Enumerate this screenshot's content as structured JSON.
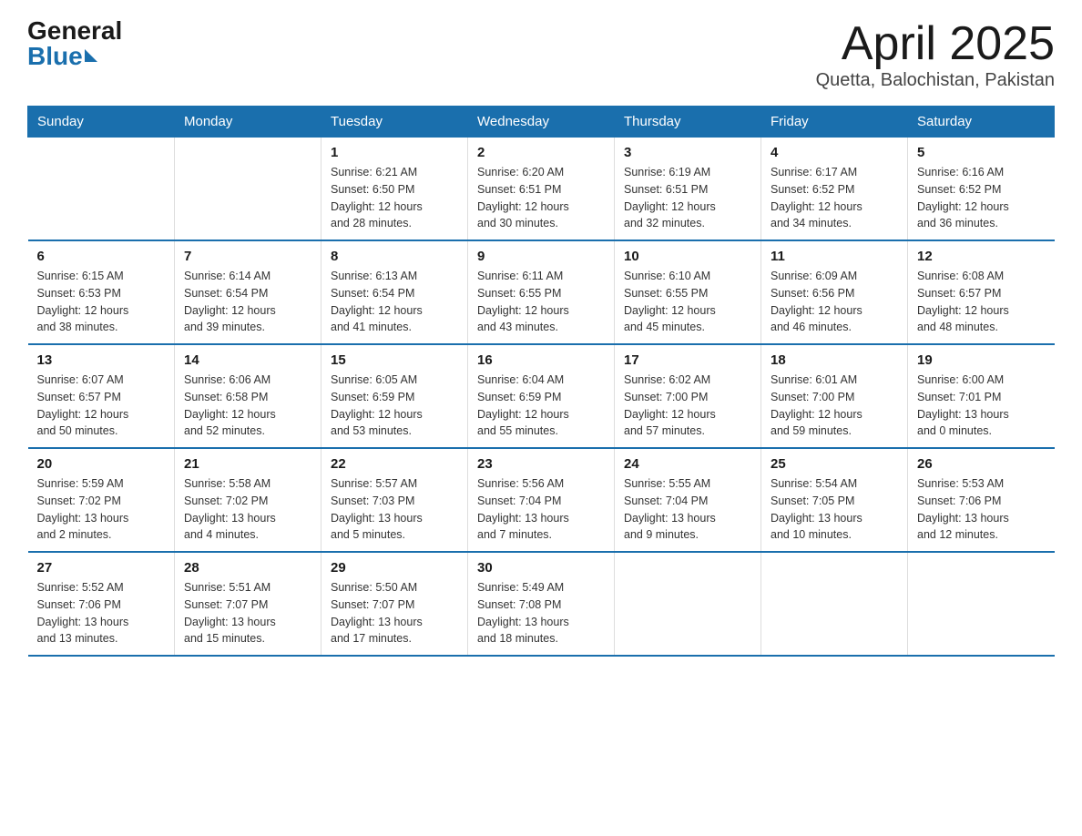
{
  "logo": {
    "general": "General",
    "blue": "Blue"
  },
  "title": "April 2025",
  "location": "Quetta, Balochistan, Pakistan",
  "days_of_week": [
    "Sunday",
    "Monday",
    "Tuesday",
    "Wednesday",
    "Thursday",
    "Friday",
    "Saturday"
  ],
  "weeks": [
    [
      {
        "day": "",
        "info": ""
      },
      {
        "day": "",
        "info": ""
      },
      {
        "day": "1",
        "info": "Sunrise: 6:21 AM\nSunset: 6:50 PM\nDaylight: 12 hours\nand 28 minutes."
      },
      {
        "day": "2",
        "info": "Sunrise: 6:20 AM\nSunset: 6:51 PM\nDaylight: 12 hours\nand 30 minutes."
      },
      {
        "day": "3",
        "info": "Sunrise: 6:19 AM\nSunset: 6:51 PM\nDaylight: 12 hours\nand 32 minutes."
      },
      {
        "day": "4",
        "info": "Sunrise: 6:17 AM\nSunset: 6:52 PM\nDaylight: 12 hours\nand 34 minutes."
      },
      {
        "day": "5",
        "info": "Sunrise: 6:16 AM\nSunset: 6:52 PM\nDaylight: 12 hours\nand 36 minutes."
      }
    ],
    [
      {
        "day": "6",
        "info": "Sunrise: 6:15 AM\nSunset: 6:53 PM\nDaylight: 12 hours\nand 38 minutes."
      },
      {
        "day": "7",
        "info": "Sunrise: 6:14 AM\nSunset: 6:54 PM\nDaylight: 12 hours\nand 39 minutes."
      },
      {
        "day": "8",
        "info": "Sunrise: 6:13 AM\nSunset: 6:54 PM\nDaylight: 12 hours\nand 41 minutes."
      },
      {
        "day": "9",
        "info": "Sunrise: 6:11 AM\nSunset: 6:55 PM\nDaylight: 12 hours\nand 43 minutes."
      },
      {
        "day": "10",
        "info": "Sunrise: 6:10 AM\nSunset: 6:55 PM\nDaylight: 12 hours\nand 45 minutes."
      },
      {
        "day": "11",
        "info": "Sunrise: 6:09 AM\nSunset: 6:56 PM\nDaylight: 12 hours\nand 46 minutes."
      },
      {
        "day": "12",
        "info": "Sunrise: 6:08 AM\nSunset: 6:57 PM\nDaylight: 12 hours\nand 48 minutes."
      }
    ],
    [
      {
        "day": "13",
        "info": "Sunrise: 6:07 AM\nSunset: 6:57 PM\nDaylight: 12 hours\nand 50 minutes."
      },
      {
        "day": "14",
        "info": "Sunrise: 6:06 AM\nSunset: 6:58 PM\nDaylight: 12 hours\nand 52 minutes."
      },
      {
        "day": "15",
        "info": "Sunrise: 6:05 AM\nSunset: 6:59 PM\nDaylight: 12 hours\nand 53 minutes."
      },
      {
        "day": "16",
        "info": "Sunrise: 6:04 AM\nSunset: 6:59 PM\nDaylight: 12 hours\nand 55 minutes."
      },
      {
        "day": "17",
        "info": "Sunrise: 6:02 AM\nSunset: 7:00 PM\nDaylight: 12 hours\nand 57 minutes."
      },
      {
        "day": "18",
        "info": "Sunrise: 6:01 AM\nSunset: 7:00 PM\nDaylight: 12 hours\nand 59 minutes."
      },
      {
        "day": "19",
        "info": "Sunrise: 6:00 AM\nSunset: 7:01 PM\nDaylight: 13 hours\nand 0 minutes."
      }
    ],
    [
      {
        "day": "20",
        "info": "Sunrise: 5:59 AM\nSunset: 7:02 PM\nDaylight: 13 hours\nand 2 minutes."
      },
      {
        "day": "21",
        "info": "Sunrise: 5:58 AM\nSunset: 7:02 PM\nDaylight: 13 hours\nand 4 minutes."
      },
      {
        "day": "22",
        "info": "Sunrise: 5:57 AM\nSunset: 7:03 PM\nDaylight: 13 hours\nand 5 minutes."
      },
      {
        "day": "23",
        "info": "Sunrise: 5:56 AM\nSunset: 7:04 PM\nDaylight: 13 hours\nand 7 minutes."
      },
      {
        "day": "24",
        "info": "Sunrise: 5:55 AM\nSunset: 7:04 PM\nDaylight: 13 hours\nand 9 minutes."
      },
      {
        "day": "25",
        "info": "Sunrise: 5:54 AM\nSunset: 7:05 PM\nDaylight: 13 hours\nand 10 minutes."
      },
      {
        "day": "26",
        "info": "Sunrise: 5:53 AM\nSunset: 7:06 PM\nDaylight: 13 hours\nand 12 minutes."
      }
    ],
    [
      {
        "day": "27",
        "info": "Sunrise: 5:52 AM\nSunset: 7:06 PM\nDaylight: 13 hours\nand 13 minutes."
      },
      {
        "day": "28",
        "info": "Sunrise: 5:51 AM\nSunset: 7:07 PM\nDaylight: 13 hours\nand 15 minutes."
      },
      {
        "day": "29",
        "info": "Sunrise: 5:50 AM\nSunset: 7:07 PM\nDaylight: 13 hours\nand 17 minutes."
      },
      {
        "day": "30",
        "info": "Sunrise: 5:49 AM\nSunset: 7:08 PM\nDaylight: 13 hours\nand 18 minutes."
      },
      {
        "day": "",
        "info": ""
      },
      {
        "day": "",
        "info": ""
      },
      {
        "day": "",
        "info": ""
      }
    ]
  ]
}
